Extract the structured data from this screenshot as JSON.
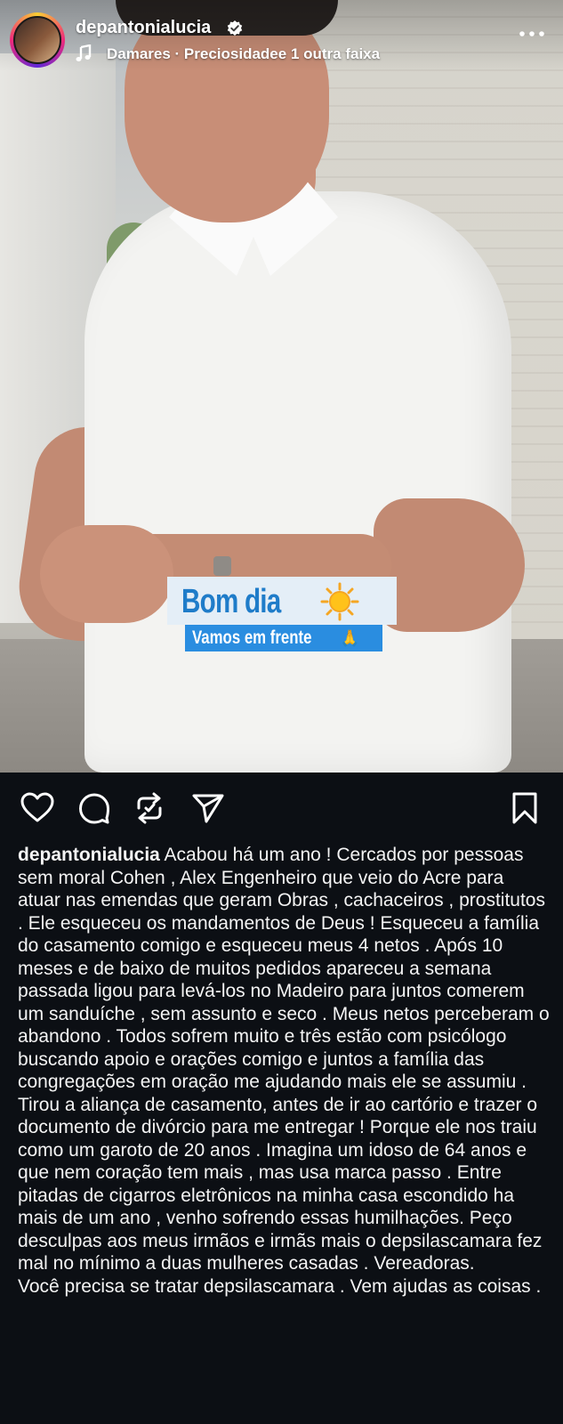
{
  "header": {
    "username": "depantonialucia",
    "verified": true,
    "music": "Damares · Preciosidadee 1 outra faixa",
    "more_icon": "more-horizontal-icon"
  },
  "sticker": {
    "title": "Bom dia",
    "subtitle": "Vamos em frente",
    "emoji_sun": "sun-emoji",
    "emoji_pray": "🙏"
  },
  "actions": {
    "like_icon": "heart-icon",
    "comment_icon": "comment-icon",
    "repost_icon": "repost-icon",
    "share_icon": "send-icon",
    "save_icon": "bookmark-icon"
  },
  "caption": {
    "username": "depantonialucia",
    "text": "Acabou há um ano ! Cercados por pessoas sem moral Cohen , Alex Engenheiro que veio do Acre  para atuar nas emendas que geram Obras , cachaceiros , prostitutos . Ele esqueceu os mandamentos de Deus ! Esqueceu a família do casamento comigo e esqueceu meus 4 netos . Após 10 meses e de baixo de muitos pedidos apareceu a semana passada ligou para levá-los no Madeiro para juntos comerem um sanduíche , sem assunto e seco . Meus netos perceberam o abandono . Todos sofrem muito e três estão com psicólogo buscando apoio e orações comigo e juntos  a família das congregações em oração me ajudando mais ele se assumiu . Tirou a aliança de casamento, antes de ir ao cartório e trazer o documento de divórcio para me entregar ! Porque ele nos traiu como um garoto de 20 anos . Imagina um idoso de 64 anos e que nem coração tem mais , mas usa marca passo . Entre pitadas de cigarros eletrônicos na minha casa escondido ha mais de um ano , venho sofrendo essas humilhações. Peço desculpas aos meus irmãos e irmãs mais o depsilascamara fez mal no mínimo a duas mulheres casadas . Vereadoras.",
    "text2": "Você precisa se tratar depsilascamara . Vem ajudas as coisas ."
  },
  "colors": {
    "background": "#0c0f14",
    "text": "#f4f4f4",
    "sticker_blue": "#1f7cc9",
    "sticker_sub_bg": "#2a8de0"
  }
}
